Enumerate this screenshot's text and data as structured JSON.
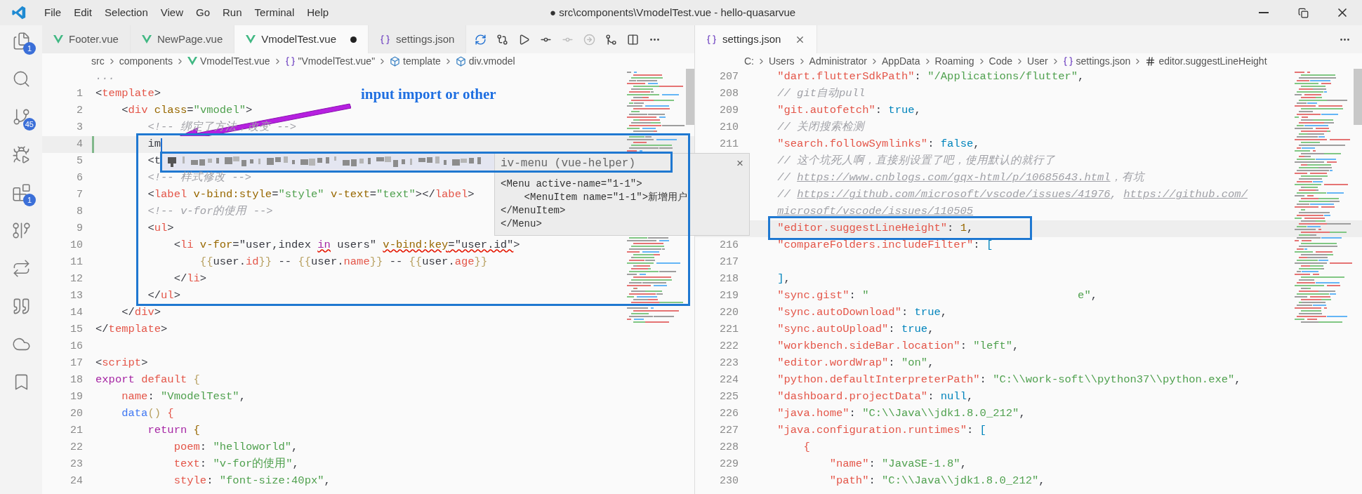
{
  "title_bar": {
    "menu": [
      "File",
      "Edit",
      "Selection",
      "View",
      "Go",
      "Run",
      "Terminal",
      "Help"
    ],
    "title": "● src\\components\\VmodelTest.vue - hello-quasarvue"
  },
  "activity_bar": [
    {
      "kind": "files",
      "badge": "1"
    },
    {
      "kind": "search"
    },
    {
      "kind": "source-control",
      "badge": "45"
    },
    {
      "kind": "run"
    },
    {
      "kind": "extensions",
      "badge": "1"
    },
    {
      "kind": "graph"
    },
    {
      "kind": "sync"
    },
    {
      "kind": "quote"
    },
    {
      "kind": "cloud"
    },
    {
      "kind": "bookmark"
    }
  ],
  "left_editor": {
    "tabs": [
      {
        "label": "Footer.vue",
        "kind": "vue",
        "selected": false,
        "dirty": false
      },
      {
        "label": "NewPage.vue",
        "kind": "vue",
        "selected": false,
        "dirty": false
      },
      {
        "label": "VmodelTest.vue",
        "kind": "vue",
        "selected": true,
        "dirty": true
      },
      {
        "label": "settings.json",
        "kind": "json",
        "selected": false,
        "dirty": false
      }
    ],
    "toolbar": [
      {
        "kind": "sync",
        "disabled": false
      },
      {
        "kind": "compare",
        "disabled": false
      },
      {
        "kind": "play",
        "disabled": false
      },
      {
        "kind": "commit",
        "disabled": false
      },
      {
        "kind": "commit",
        "disabled": true
      },
      {
        "kind": "next",
        "disabled": true
      },
      {
        "kind": "merge",
        "disabled": false
      },
      {
        "kind": "split",
        "disabled": false
      },
      {
        "kind": "more",
        "disabled": false
      }
    ],
    "breadcrumb": [
      {
        "label": "src",
        "kind": "plain"
      },
      {
        "label": "components",
        "kind": "plain"
      },
      {
        "label": "VmodelTest.vue",
        "kind": "vue"
      },
      {
        "label": "\"VmodelTest.vue\"",
        "kind": "braces"
      },
      {
        "label": "template",
        "kind": "box"
      },
      {
        "label": "div.vmodel",
        "kind": "box"
      }
    ],
    "lines": [
      {
        "t": [
          {
            "text": "...",
            "kind": "cm"
          }
        ],
        "current": false,
        "modified": false
      },
      {
        "n": "1",
        "t": [
          {
            "text": "<",
            "kind": "p"
          },
          {
            "text": "template",
            "kind": "tag"
          },
          {
            "text": ">",
            "kind": "p"
          }
        ],
        "current": false,
        "modified": false
      },
      {
        "n": "2",
        "t": [
          {
            "text": "    <",
            "kind": "p"
          },
          {
            "text": "div ",
            "kind": "tag"
          },
          {
            "text": "class",
            "kind": "attr"
          },
          {
            "text": "=",
            "kind": "p"
          },
          {
            "text": "\"vmodel\"",
            "kind": "str"
          },
          {
            "text": ">",
            "kind": "p"
          }
        ],
        "current": false,
        "modified": false
      },
      {
        "n": "3",
        "t": [
          {
            "text": "        <!-- 绑定了方法，改变 -->",
            "kind": "cm"
          }
        ],
        "current": false,
        "modified": false
      },
      {
        "n": "4",
        "t": [
          {
            "text": "        im",
            "kind": "typing"
          }
        ],
        "current": true,
        "modified": true
      },
      {
        "n": "5",
        "t": [
          {
            "text": "        <t",
            "kind": "p"
          }
        ],
        "current": false,
        "modified": false
      },
      {
        "n": "6",
        "t": [
          {
            "text": "        <!-- 样式修改 -->",
            "kind": "cm"
          }
        ],
        "current": false,
        "modified": false
      },
      {
        "n": "7",
        "t": [
          {
            "text": "        <",
            "kind": "p"
          },
          {
            "text": "label ",
            "kind": "tag"
          },
          {
            "text": "v-bind:style",
            "kind": "attr"
          },
          {
            "text": "=",
            "kind": "p"
          },
          {
            "text": "\"style\" ",
            "kind": "str"
          },
          {
            "text": "v-text",
            "kind": "attr"
          },
          {
            "text": "=",
            "kind": "p"
          },
          {
            "text": "\"text\"",
            "kind": "str"
          },
          {
            "text": "></",
            "kind": "p"
          },
          {
            "text": "label",
            "kind": "tag"
          },
          {
            "text": ">",
            "kind": "p"
          }
        ],
        "current": false,
        "modified": false
      },
      {
        "n": "8",
        "t": [
          {
            "text": "        <!-- v-for的使用 -->",
            "kind": "cm"
          }
        ],
        "current": false,
        "modified": false
      },
      {
        "n": "9",
        "t": [
          {
            "text": "        <",
            "kind": "p"
          },
          {
            "text": "ul",
            "kind": "tag"
          },
          {
            "text": ">",
            "kind": "p"
          }
        ],
        "current": false,
        "modified": false
      },
      {
        "n": "10",
        "t": [
          {
            "text": "            <",
            "kind": "p"
          },
          {
            "text": "li ",
            "kind": "tag"
          },
          {
            "text": "v-for",
            "kind": "attr"
          },
          {
            "text": "=\"user,index ",
            "kind": "p"
          },
          {
            "text": "in",
            "kind": "kwW"
          },
          {
            "text": " users\" ",
            "kind": "p"
          },
          {
            "text": "v-bind:key",
            "kind": "attrW"
          },
          {
            "text": "=\"user.id\"",
            "kind": "pW"
          },
          {
            "text": ">",
            "kind": "p"
          }
        ],
        "current": false,
        "modified": false
      },
      {
        "n": "11",
        "t": [
          {
            "text": "                {{",
            "kind": "br"
          },
          {
            "text": "user.",
            "kind": "p"
          },
          {
            "text": "id",
            "kind": "tag"
          },
          {
            "text": "}}",
            "kind": "br"
          },
          {
            "text": " -- ",
            "kind": "p"
          },
          {
            "text": "{{",
            "kind": "br"
          },
          {
            "text": "user.",
            "kind": "p"
          },
          {
            "text": "name",
            "kind": "tag"
          },
          {
            "text": "}}",
            "kind": "br"
          },
          {
            "text": " -- ",
            "kind": "p"
          },
          {
            "text": "{{",
            "kind": "br"
          },
          {
            "text": "user.",
            "kind": "p"
          },
          {
            "text": "age",
            "kind": "tag"
          },
          {
            "text": "}}",
            "kind": "br"
          }
        ],
        "current": false,
        "modified": false
      },
      {
        "n": "12",
        "t": [
          {
            "text": "            </",
            "kind": "p"
          },
          {
            "text": "li",
            "kind": "tag"
          },
          {
            "text": ">",
            "kind": "p"
          }
        ],
        "current": false,
        "modified": false
      },
      {
        "n": "13",
        "t": [
          {
            "text": "        </",
            "kind": "p"
          },
          {
            "text": "ul",
            "kind": "tag"
          },
          {
            "text": ">",
            "kind": "p"
          }
        ],
        "current": false,
        "modified": false
      },
      {
        "n": "14",
        "t": [
          {
            "text": "    </",
            "kind": "p"
          },
          {
            "text": "div",
            "kind": "tag"
          },
          {
            "text": ">",
            "kind": "p"
          }
        ],
        "current": false,
        "modified": false
      },
      {
        "n": "15",
        "t": [
          {
            "text": "</",
            "kind": "p"
          },
          {
            "text": "template",
            "kind": "tag"
          },
          {
            "text": ">",
            "kind": "p"
          }
        ],
        "current": false,
        "modified": false
      },
      {
        "n": "16",
        "current": false,
        "modified": false
      },
      {
        "n": "17",
        "t": [
          {
            "text": "<",
            "kind": "p"
          },
          {
            "text": "script",
            "kind": "tag"
          },
          {
            "text": ">",
            "kind": "p"
          }
        ],
        "current": false,
        "modified": false
      },
      {
        "n": "18",
        "t": [
          {
            "text": "export ",
            "kind": "kw"
          },
          {
            "text": "default ",
            "kind": "tag"
          },
          {
            "text": "{",
            "kind": "br"
          }
        ],
        "current": false,
        "modified": false
      },
      {
        "n": "19",
        "t": [
          {
            "text": "    name",
            "kind": "tag"
          },
          {
            "text": ": ",
            "kind": "p"
          },
          {
            "text": "\"VmodelTest\"",
            "kind": "str"
          },
          {
            "text": ",",
            "kind": "p"
          }
        ],
        "current": false,
        "modified": false
      },
      {
        "n": "20",
        "t": [
          {
            "text": "    data",
            "kind": "fn"
          },
          {
            "text": "() ",
            "kind": "br"
          },
          {
            "text": "{",
            "kind": "tag"
          }
        ],
        "current": false,
        "modified": false
      },
      {
        "n": "21",
        "t": [
          {
            "text": "        return ",
            "kind": "kw"
          },
          {
            "text": "{",
            "kind": "num"
          }
        ],
        "current": false,
        "modified": false
      },
      {
        "n": "22",
        "t": [
          {
            "text": "            poem",
            "kind": "tag"
          },
          {
            "text": ": ",
            "kind": "p"
          },
          {
            "text": "\"helloworld\"",
            "kind": "str"
          },
          {
            "text": ",",
            "kind": "p"
          }
        ],
        "current": false,
        "modified": false
      },
      {
        "n": "23",
        "t": [
          {
            "text": "            text",
            "kind": "tag"
          },
          {
            "text": ": ",
            "kind": "p"
          },
          {
            "text": "\"v-for的使用\"",
            "kind": "str"
          },
          {
            "text": ",",
            "kind": "p"
          }
        ],
        "current": false,
        "modified": false
      },
      {
        "n": "24",
        "t": [
          {
            "text": "            style",
            "kind": "tag"
          },
          {
            "text": ": ",
            "kind": "p"
          },
          {
            "text": "\"font-size:40px\"",
            "kind": "str"
          },
          {
            "text": ",",
            "kind": "p"
          }
        ],
        "current": false,
        "modified": false
      }
    ]
  },
  "suggest_widget": {
    "detail_title": "iv-menu (vue-helper)",
    "close": "×",
    "doc": [
      "<Menu active-name=\"1-1\">",
      "    <MenuItem name=\"1-1\">新增用户",
      "</MenuItem>",
      "</Menu>"
    ]
  },
  "right_editor": {
    "tabs": [
      {
        "label": "settings.json",
        "kind": "json",
        "selected": true,
        "dirty": false
      }
    ],
    "toolbar": [
      {
        "kind": "more",
        "disabled": false
      }
    ],
    "breadcrumb": [
      {
        "label": "C:",
        "kind": "plain"
      },
      {
        "label": "Users",
        "kind": "plain"
      },
      {
        "label": "Administrator",
        "kind": "plain"
      },
      {
        "label": "AppData",
        "kind": "plain"
      },
      {
        "label": "Roaming",
        "kind": "plain"
      },
      {
        "label": "Code",
        "kind": "plain"
      },
      {
        "label": "User",
        "kind": "plain"
      },
      {
        "label": "settings.json",
        "kind": "braces"
      },
      {
        "label": "editor.suggestLineHeight",
        "kind": "hash"
      }
    ],
    "lines": [
      {
        "n": "207",
        "t": [
          {
            "text": "    \"dart.flutterSdkPath\"",
            "kind": "key"
          },
          {
            "text": ": ",
            "kind": "p"
          },
          {
            "text": "\"/Applications/flutter\"",
            "kind": "str"
          },
          {
            "text": ",",
            "kind": "p"
          }
        ],
        "current": false,
        "modified": false
      },
      {
        "n": "208",
        "t": [
          {
            "text": "    // git自动pull",
            "kind": "cm"
          }
        ],
        "current": false,
        "modified": false
      },
      {
        "n": "209",
        "t": [
          {
            "text": "    \"git.autofetch\"",
            "kind": "key"
          },
          {
            "text": ": ",
            "kind": "p"
          },
          {
            "text": "true",
            "kind": "bool"
          },
          {
            "text": ",",
            "kind": "p"
          }
        ],
        "current": false,
        "modified": false
      },
      {
        "n": "210",
        "t": [
          {
            "text": "    // 关闭搜索检测",
            "kind": "cm"
          }
        ],
        "current": false,
        "modified": false
      },
      {
        "n": "211",
        "t": [
          {
            "text": "    \"search.followSymlinks\"",
            "kind": "key"
          },
          {
            "text": ": ",
            "kind": "p"
          },
          {
            "text": "false",
            "kind": "bool"
          },
          {
            "text": ",",
            "kind": "p"
          }
        ],
        "current": false,
        "modified": false
      },
      {
        "t": [
          {
            "text": "    // 这个坑死人啊，直接别设置了吧，使用默认的就行了",
            "kind": "cm"
          }
        ],
        "current": false,
        "modified": false
      },
      {
        "t": [
          {
            "text": "    // ",
            "kind": "cm"
          },
          {
            "text": "https://www.cnblogs.com/gqx-html/p/10685643.html",
            "kind": "url"
          },
          {
            "text": "，有坑",
            "kind": "cm"
          }
        ],
        "current": false,
        "modified": false
      },
      {
        "t": [
          {
            "text": "    // ",
            "kind": "cm"
          },
          {
            "text": "https://github.com/microsoft/vscode/issues/41976",
            "kind": "url"
          },
          {
            "text": ", ",
            "kind": "cm"
          },
          {
            "text": "https://github.com/",
            "kind": "url"
          }
        ],
        "current": false,
        "modified": false
      },
      {
        "t": [
          {
            "text": "microsoft/vscode/issues/110505",
            "kind": "urlWrap"
          }
        ],
        "current": false,
        "modified": false
      },
      {
        "t": [
          {
            "text": "    \"editor.suggestLineHeight\"",
            "kind": "key"
          },
          {
            "text": ": ",
            "kind": "p"
          },
          {
            "text": "1",
            "kind": "num"
          },
          {
            "text": ",",
            "kind": "p"
          }
        ],
        "current": true,
        "modified": false
      },
      {
        "n": "216",
        "t": [
          {
            "text": "    \"compareFolders.includeFilter\"",
            "kind": "key"
          },
          {
            "text": ": ",
            "kind": "p"
          },
          {
            "text": "[",
            "kind": "bool"
          }
        ],
        "current": false,
        "modified": false
      },
      {
        "n": "217",
        "current": false,
        "modified": false
      },
      {
        "n": "218",
        "t": [
          {
            "text": "    ]",
            "kind": "bool"
          },
          {
            "text": ",",
            "kind": "p"
          }
        ],
        "current": false,
        "modified": false
      },
      {
        "n": "219",
        "t": [
          {
            "text": "    \"sync.gist\"",
            "kind": "key"
          },
          {
            "text": ": ",
            "kind": "p"
          },
          {
            "text": "\"                                e\"",
            "kind": "str"
          },
          {
            "text": ",",
            "kind": "p"
          }
        ],
        "current": false,
        "modified": false
      },
      {
        "n": "220",
        "t": [
          {
            "text": "    \"sync.autoDownload\"",
            "kind": "key"
          },
          {
            "text": ": ",
            "kind": "p"
          },
          {
            "text": "true",
            "kind": "bool"
          },
          {
            "text": ",",
            "kind": "p"
          }
        ],
        "current": false,
        "modified": false
      },
      {
        "n": "221",
        "t": [
          {
            "text": "    \"sync.autoUpload\"",
            "kind": "key"
          },
          {
            "text": ": ",
            "kind": "p"
          },
          {
            "text": "true",
            "kind": "bool"
          },
          {
            "text": ",",
            "kind": "p"
          }
        ],
        "current": false,
        "modified": false
      },
      {
        "n": "222",
        "t": [
          {
            "text": "    \"workbench.sideBar.location\"",
            "kind": "key"
          },
          {
            "text": ": ",
            "kind": "p"
          },
          {
            "text": "\"left\"",
            "kind": "str"
          },
          {
            "text": ",",
            "kind": "p"
          }
        ],
        "current": false,
        "modified": false
      },
      {
        "n": "223",
        "t": [
          {
            "text": "    \"editor.wordWrap\"",
            "kind": "key"
          },
          {
            "text": ": ",
            "kind": "p"
          },
          {
            "text": "\"on\"",
            "kind": "str"
          },
          {
            "text": ",",
            "kind": "p"
          }
        ],
        "current": false,
        "modified": false
      },
      {
        "n": "224",
        "t": [
          {
            "text": "    \"python.defaultInterpreterPath\"",
            "kind": "key"
          },
          {
            "text": ": ",
            "kind": "p"
          },
          {
            "text": "\"C:\\\\work-soft\\\\python37\\\\python.exe\"",
            "kind": "str"
          },
          {
            "text": ",",
            "kind": "p"
          }
        ],
        "current": false,
        "modified": false
      },
      {
        "n": "225",
        "t": [
          {
            "text": "    \"dashboard.projectData\"",
            "kind": "key"
          },
          {
            "text": ": ",
            "kind": "p"
          },
          {
            "text": "null",
            "kind": "bool"
          },
          {
            "text": ",",
            "kind": "p"
          }
        ],
        "current": false,
        "modified": false
      },
      {
        "n": "226",
        "t": [
          {
            "text": "    \"java.home\"",
            "kind": "key"
          },
          {
            "text": ": ",
            "kind": "p"
          },
          {
            "text": "\"C:\\\\Java\\\\jdk1.8.0_212\"",
            "kind": "str"
          },
          {
            "text": ",",
            "kind": "p"
          }
        ],
        "current": false,
        "modified": false
      },
      {
        "n": "227",
        "t": [
          {
            "text": "    \"java.configuration.runtimes\"",
            "kind": "key"
          },
          {
            "text": ": ",
            "kind": "p"
          },
          {
            "text": "[",
            "kind": "bool"
          }
        ],
        "current": false,
        "modified": false
      },
      {
        "n": "228",
        "t": [
          {
            "text": "        {",
            "kind": "tag"
          }
        ],
        "current": false,
        "modified": false
      },
      {
        "n": "229",
        "t": [
          {
            "text": "            \"name\"",
            "kind": "key"
          },
          {
            "text": ": ",
            "kind": "p"
          },
          {
            "text": "\"JavaSE-1.8\"",
            "kind": "str"
          },
          {
            "text": ",",
            "kind": "p"
          }
        ],
        "current": false,
        "modified": false
      },
      {
        "n": "230",
        "t": [
          {
            "text": "            \"path\"",
            "kind": "key"
          },
          {
            "text": ": ",
            "kind": "p"
          },
          {
            "text": "\"C:\\\\Java\\\\jdk1.8.0_212\"",
            "kind": "str"
          },
          {
            "text": ",",
            "kind": "p"
          }
        ],
        "current": false,
        "modified": false
      }
    ]
  },
  "annotation": {
    "label": "input import or other"
  }
}
